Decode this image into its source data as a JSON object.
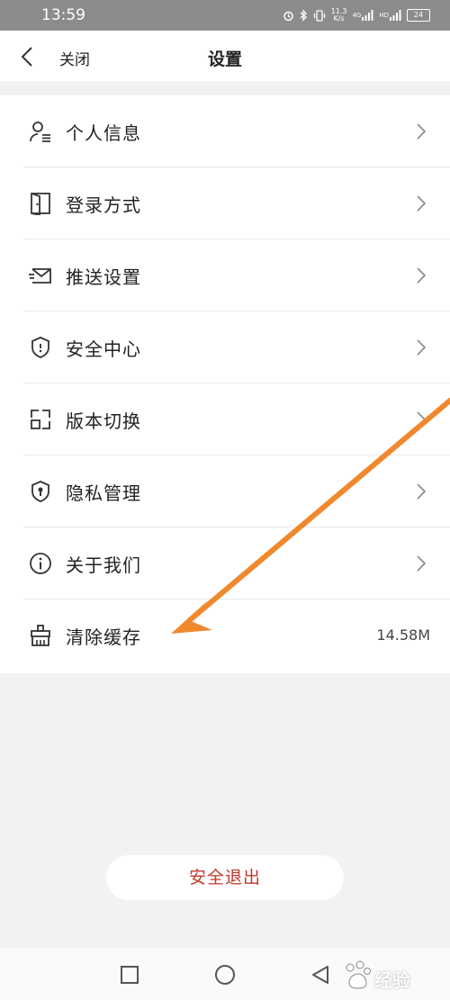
{
  "status_bar": {
    "time": "13:59",
    "net_speed_value": "11.3",
    "net_speed_unit": "K/s",
    "signal1_label": "4G",
    "signal2_label": "HD",
    "battery": "24"
  },
  "header": {
    "close_label": "关闭",
    "title": "设置"
  },
  "settings": {
    "items": [
      {
        "label": "个人信息",
        "icon": "user-card-icon"
      },
      {
        "label": "登录方式",
        "icon": "door-icon"
      },
      {
        "label": "推送设置",
        "icon": "envelope-icon"
      },
      {
        "label": "安全中心",
        "icon": "shield-icon"
      },
      {
        "label": "版本切换",
        "icon": "switch-icon"
      },
      {
        "label": "隐私管理",
        "icon": "privacy-shield-icon"
      },
      {
        "label": "关于我们",
        "icon": "info-icon"
      },
      {
        "label": "清除缓存",
        "icon": "broom-icon",
        "value": "14.58M"
      }
    ]
  },
  "logout_label": "安全退出",
  "annotation": {
    "color": "#F0882E"
  },
  "watermark": {
    "text": "经验"
  }
}
